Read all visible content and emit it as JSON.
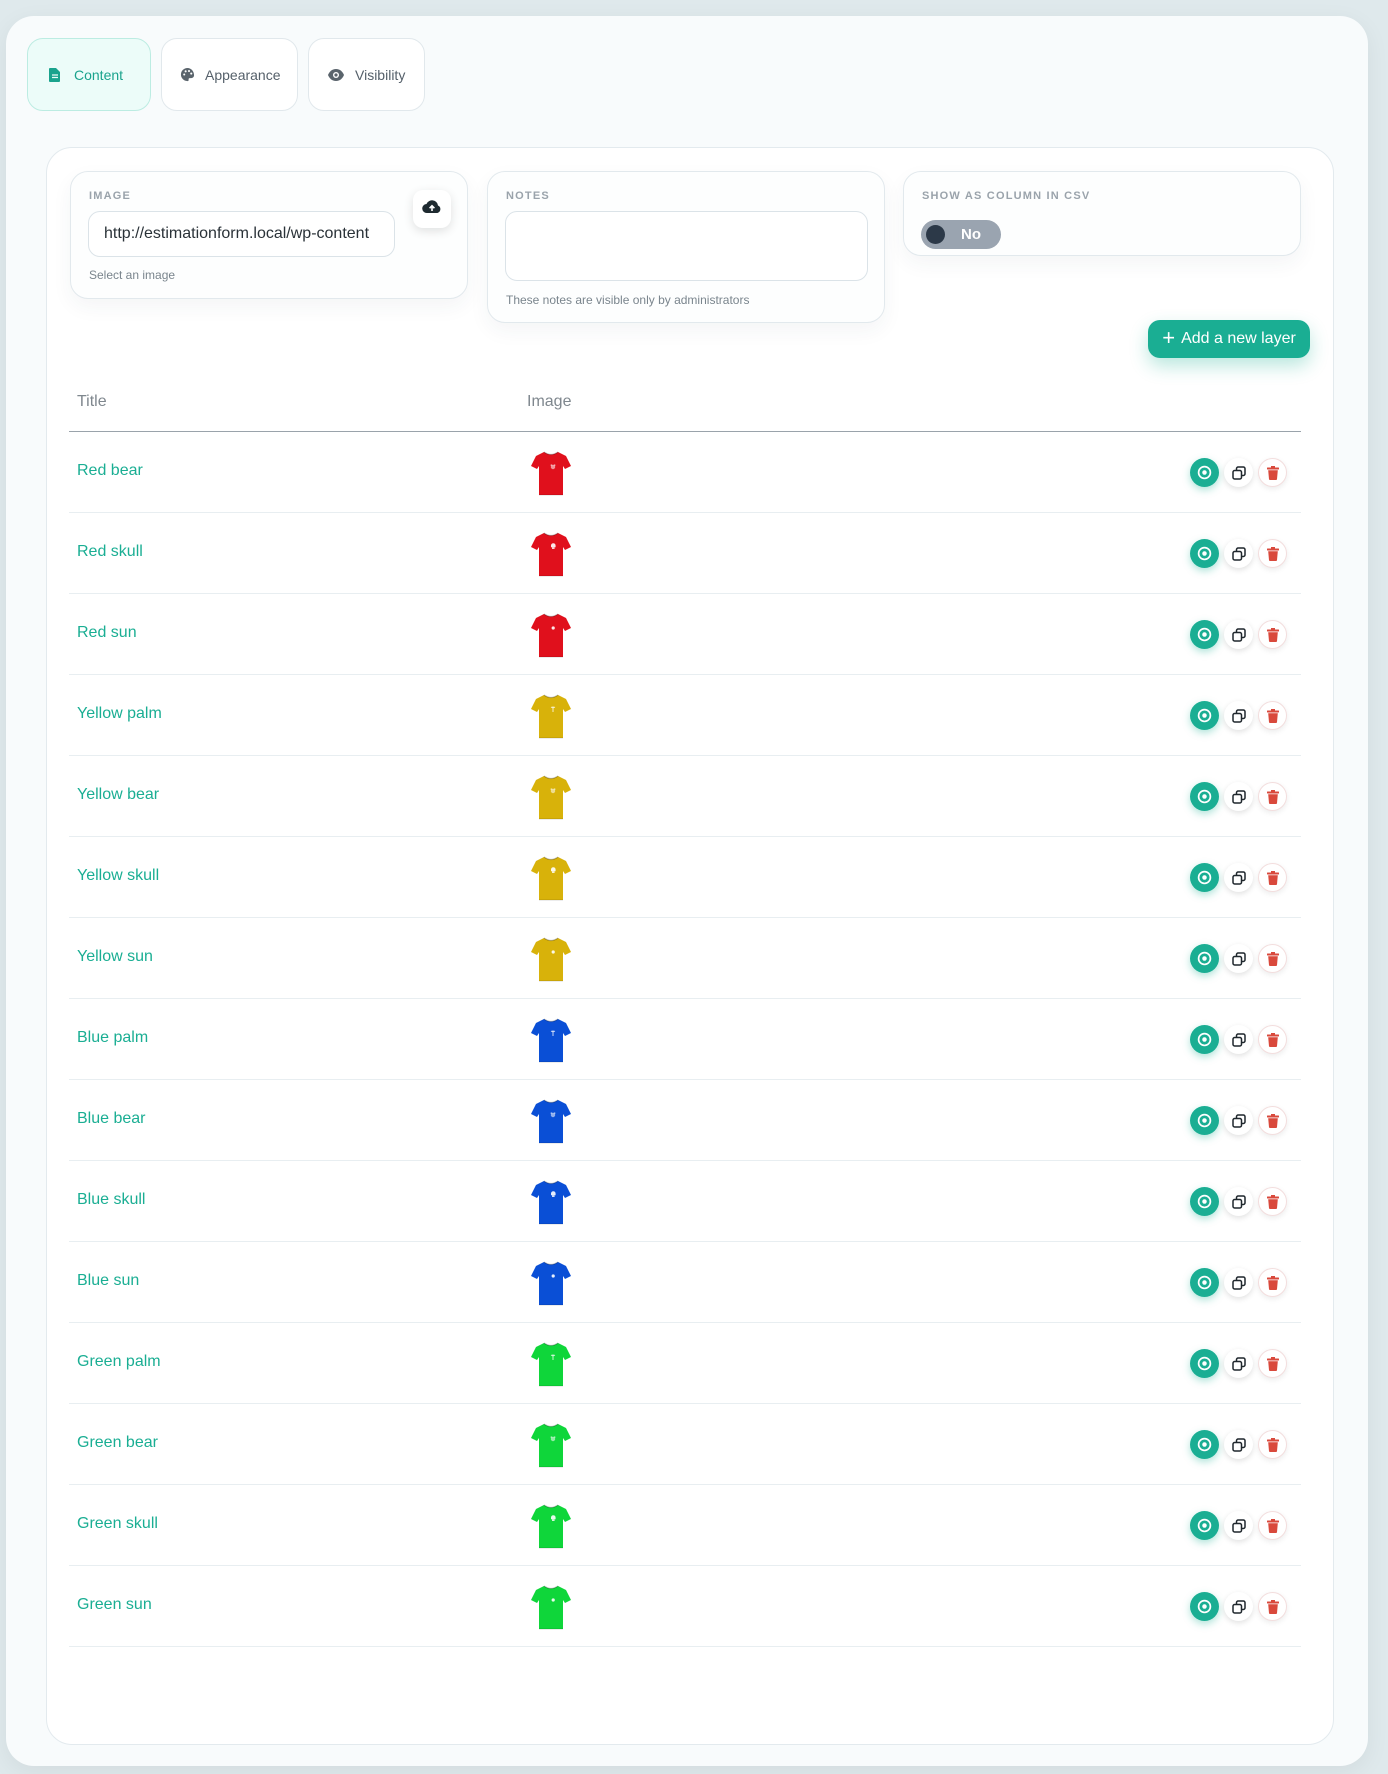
{
  "tabs": [
    {
      "label": "Content",
      "icon": "file-icon",
      "active": true
    },
    {
      "label": "Appearance",
      "icon": "palette-icon",
      "active": false
    },
    {
      "label": "Visibility",
      "icon": "eye-icon",
      "active": false
    }
  ],
  "image_field": {
    "label": "IMAGE",
    "value": "http://estimationform.local/wp-content",
    "help": "Select an image",
    "upload_icon": "cloud-upload-icon"
  },
  "notes_field": {
    "label": "NOTES",
    "value": "",
    "help": "These notes are visible only by administrators"
  },
  "csv_field": {
    "label": "SHOW AS COLUMN IN CSV",
    "toggle_label": "No",
    "checked": false
  },
  "add_layer_button": "Add a new layer",
  "table": {
    "headers": {
      "title": "Title",
      "image": "Image"
    },
    "rows": [
      {
        "title": "Red bear",
        "color": "#e0101c",
        "motif": "bear"
      },
      {
        "title": "Red skull",
        "color": "#e0101c",
        "motif": "skull"
      },
      {
        "title": "Red sun",
        "color": "#e0101c",
        "motif": "sun"
      },
      {
        "title": "Yellow palm",
        "color": "#d8b20a",
        "motif": "palm"
      },
      {
        "title": "Yellow bear",
        "color": "#d8b20a",
        "motif": "bear"
      },
      {
        "title": "Yellow skull",
        "color": "#d8b20a",
        "motif": "skull"
      },
      {
        "title": "Yellow sun",
        "color": "#d8b20a",
        "motif": "sun"
      },
      {
        "title": "Blue palm",
        "color": "#0a4fd6",
        "motif": "palm"
      },
      {
        "title": "Blue bear",
        "color": "#0a4fd6",
        "motif": "bear"
      },
      {
        "title": "Blue skull",
        "color": "#0a4fd6",
        "motif": "skull"
      },
      {
        "title": "Blue sun",
        "color": "#0a4fd6",
        "motif": "sun"
      },
      {
        "title": "Green palm",
        "color": "#0fd63a",
        "motif": "palm"
      },
      {
        "title": "Green bear",
        "color": "#0fd63a",
        "motif": "bear"
      },
      {
        "title": "Green skull",
        "color": "#0fd63a",
        "motif": "skull"
      },
      {
        "title": "Green sun",
        "color": "#0fd63a",
        "motif": "sun"
      }
    ],
    "row_actions": [
      "eye-icon",
      "duplicate-icon",
      "trash-icon"
    ]
  },
  "colors": {
    "accent": "#1aae93",
    "danger": "#d9493c",
    "toggle_off": "#9aa4b0"
  }
}
